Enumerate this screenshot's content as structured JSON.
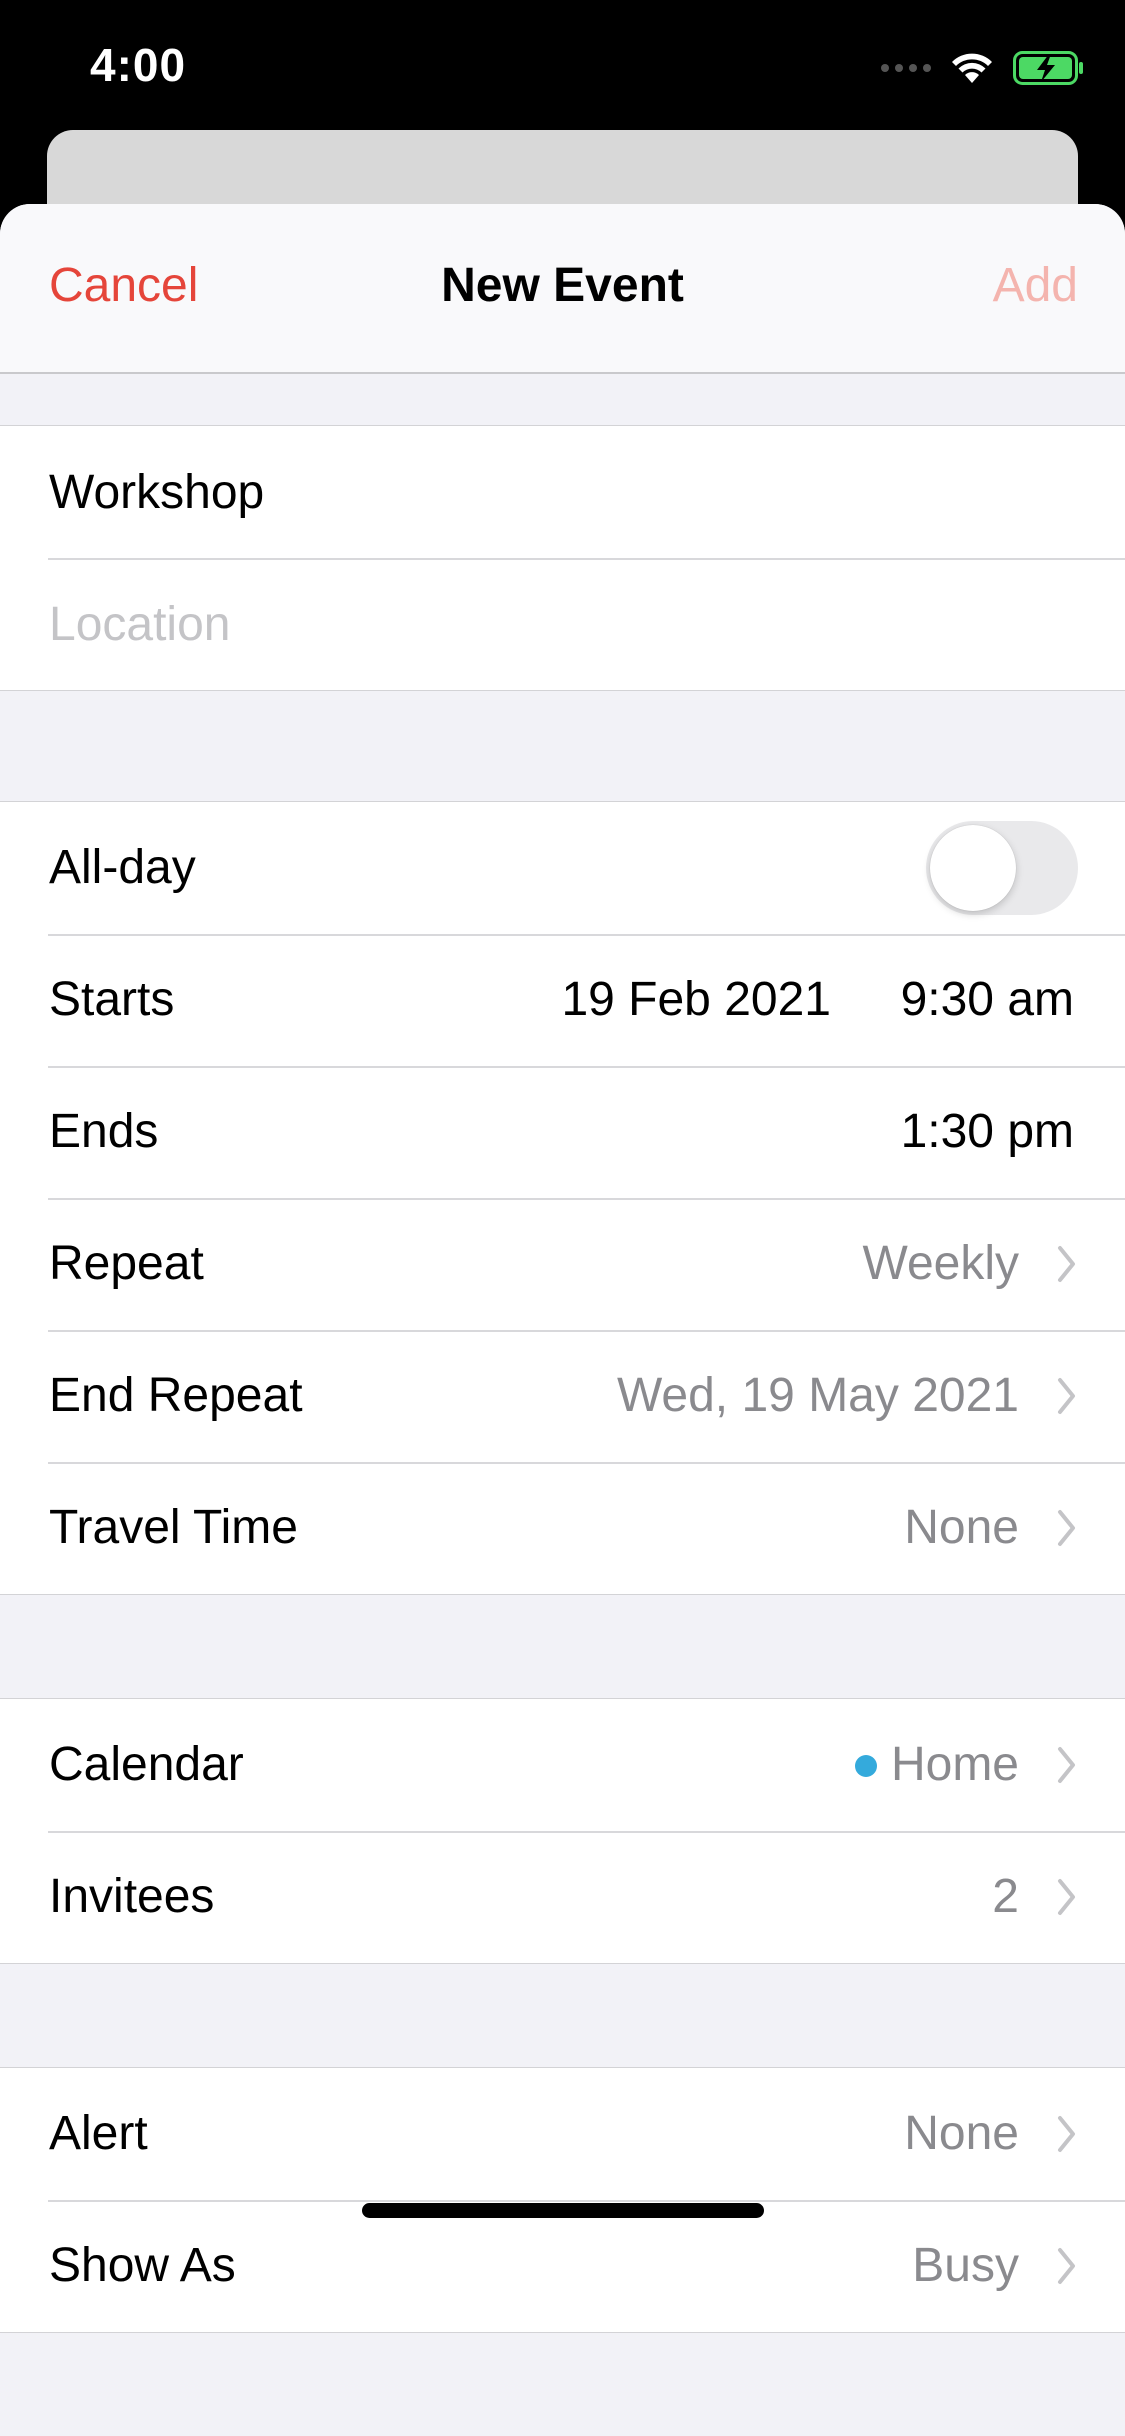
{
  "status_bar": {
    "time": "4:00",
    "icons": [
      "cellular-signal-icon",
      "wifi-icon",
      "battery-charging-icon"
    ],
    "battery_color": "#4cd964"
  },
  "navbar": {
    "cancel_label": "Cancel",
    "title": "New Event",
    "add_label": "Add"
  },
  "colors": {
    "accent": "#e5453a",
    "accent_disabled": "#f4b4ae",
    "secondary_text": "#8a8a8e",
    "placeholder_text": "#c4c4c7",
    "calendar_home": "#34aadc"
  },
  "event": {
    "title_value": "Workshop",
    "location_placeholder": "Location"
  },
  "timing": {
    "all_day_label": "All-day",
    "all_day_on": false,
    "starts_label": "Starts",
    "starts_date": "19 Feb 2021",
    "starts_time": "9:30 am",
    "ends_label": "Ends",
    "ends_time": "1:30 pm",
    "repeat_label": "Repeat",
    "repeat_value": "Weekly",
    "end_repeat_label": "End Repeat",
    "end_repeat_value": "Wed, 19 May 2021",
    "travel_time_label": "Travel Time",
    "travel_time_value": "None"
  },
  "calendar_group": {
    "calendar_label": "Calendar",
    "calendar_value": "Home",
    "invitees_label": "Invitees",
    "invitees_value": "2"
  },
  "alert_group": {
    "alert_label": "Alert",
    "alert_value": "None",
    "show_as_label": "Show As",
    "show_as_value": "Busy"
  }
}
